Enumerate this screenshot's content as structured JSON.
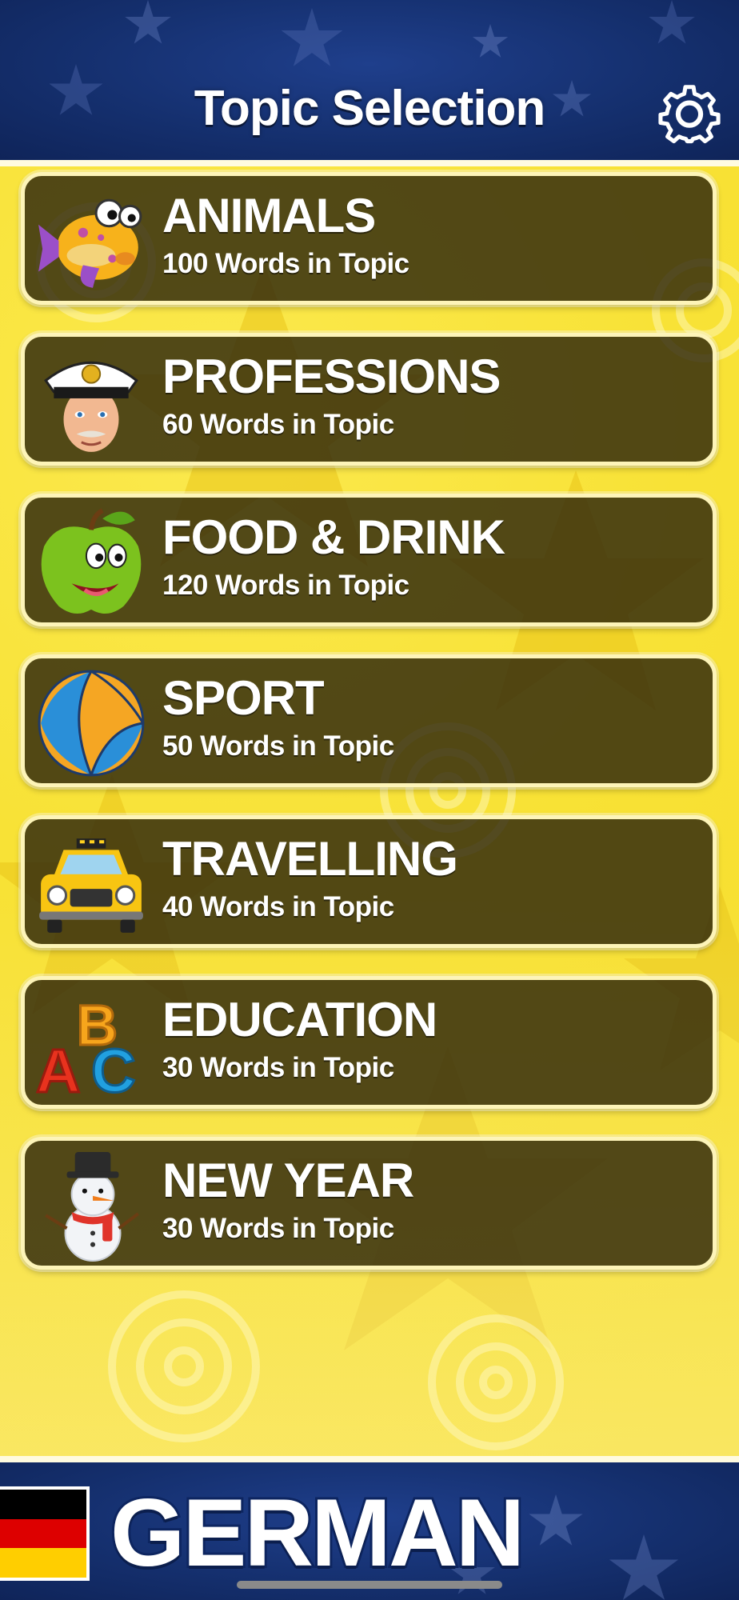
{
  "header": {
    "title": "Topic Selection",
    "settings_icon": "gear-icon"
  },
  "topics": [
    {
      "name": "ANIMALS",
      "count": "100 Words in Topic",
      "icon": "fish-icon"
    },
    {
      "name": "PROFESSIONS",
      "count": "60 Words in Topic",
      "icon": "captain-icon"
    },
    {
      "name": "FOOD & DRINK",
      "count": "120 Words in Topic",
      "icon": "apple-icon"
    },
    {
      "name": "SPORT",
      "count": "50 Words in Topic",
      "icon": "volleyball-icon"
    },
    {
      "name": "TRAVELLING",
      "count": "40 Words in Topic",
      "icon": "taxi-icon"
    },
    {
      "name": "EDUCATION",
      "count": "30 Words in Topic",
      "icon": "abc-blocks-icon"
    },
    {
      "name": "NEW YEAR",
      "count": "30 Words in Topic",
      "icon": "snowman-icon"
    }
  ],
  "footer": {
    "language": "GERMAN",
    "flag_icon": "germany-flag-icon",
    "flag_colors": [
      "#000000",
      "#dd0000",
      "#ffce00"
    ]
  },
  "colors": {
    "header_bg": "#15306f",
    "main_bg": "#f8e236",
    "card_bg": "#2d260c",
    "card_border": "#fdf4b8",
    "text": "#ffffff"
  }
}
